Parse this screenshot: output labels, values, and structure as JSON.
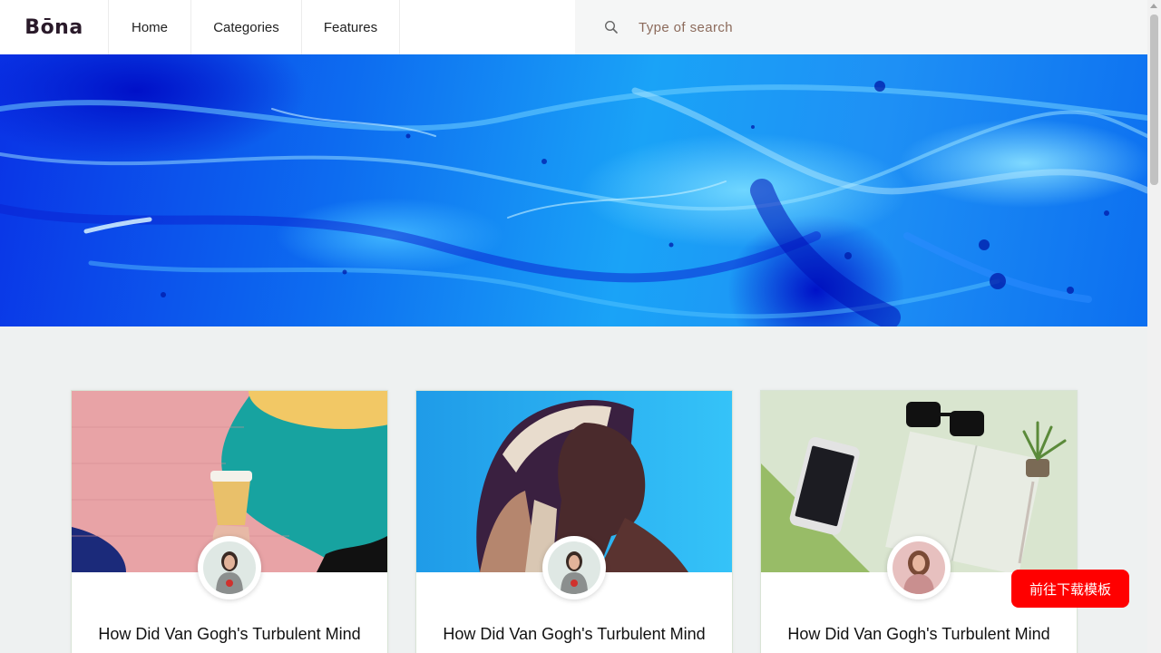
{
  "header": {
    "logo": "Bōna",
    "nav": [
      {
        "label": "Home"
      },
      {
        "label": "Categories"
      },
      {
        "label": "Features"
      }
    ],
    "search": {
      "placeholder": "Type of search",
      "icon": "search-icon"
    }
  },
  "hero": {
    "image": "blue-marble-fluid-art"
  },
  "cards": [
    {
      "title": "How Did Van Gogh's Turbulent Mind",
      "image": "coffee-cup-mural",
      "avatar": "woman-avatar"
    },
    {
      "title": "How Did Van Gogh's Turbulent Mind",
      "image": "woman-headscarf-portrait",
      "avatar": "woman-avatar"
    },
    {
      "title": "How Did Van Gogh's Turbulent Mind",
      "image": "desk-phone-notebook",
      "avatar": "woman-pink-avatar"
    }
  ],
  "download_button": {
    "label": "前往下载模板"
  },
  "colors": {
    "accent": "#ff0000",
    "background": "#eef1f1",
    "hero_blue": "#0d6cf0"
  }
}
